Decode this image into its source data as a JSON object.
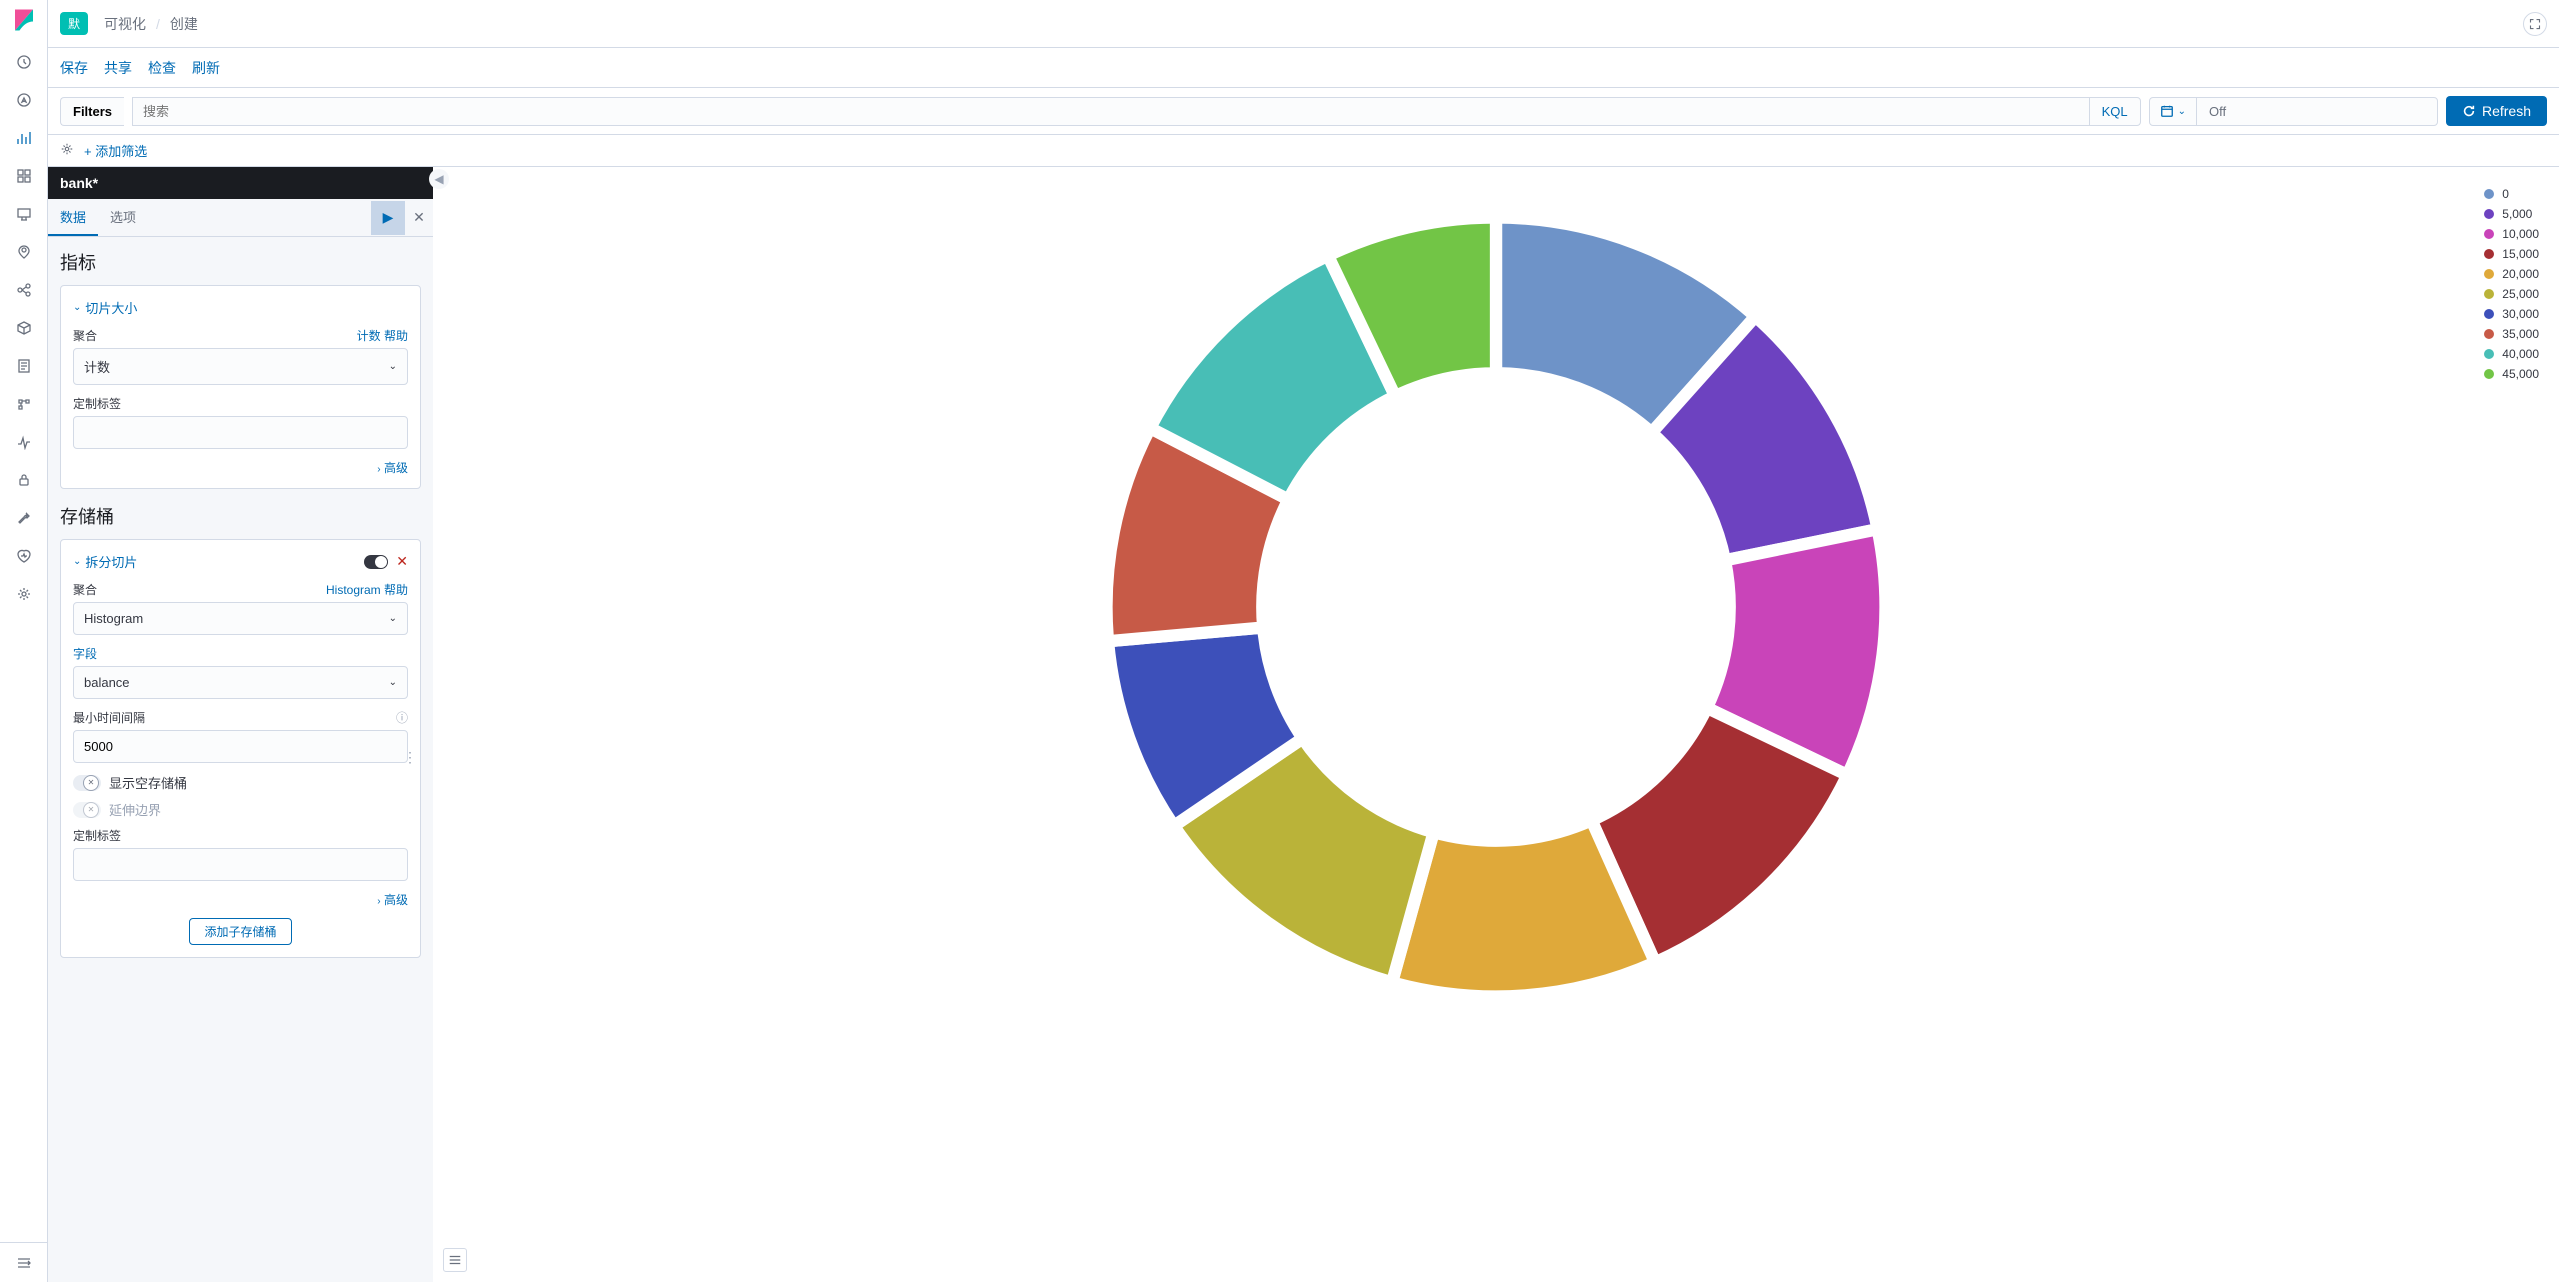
{
  "header": {
    "badge": "默",
    "breadcrumb": [
      "可视化",
      "创建"
    ]
  },
  "actions": {
    "save": "保存",
    "share": "共享",
    "inspect": "检查",
    "refresh_cn": "刷新"
  },
  "query": {
    "filters_btn": "Filters",
    "search_placeholder": "搜索",
    "kql": "KQL",
    "date_range": "Off",
    "refresh": "Refresh"
  },
  "filter_row": {
    "add_filter": "+ 添加筛选"
  },
  "sidebar": {
    "index_pattern": "bank*",
    "tabs": {
      "data": "数据",
      "options": "选项"
    },
    "metrics_title": "指标",
    "metric": {
      "header": "切片大小",
      "agg_label": "聚合",
      "agg_hint": "计数 帮助",
      "agg_value": "计数",
      "custom_label": "定制标签",
      "advanced": "高级"
    },
    "buckets_title": "存储桶",
    "bucket": {
      "header": "拆分切片",
      "agg_label": "聚合",
      "agg_hint": "Histogram 帮助",
      "agg_value": "Histogram",
      "field_label": "字段",
      "field_value": "balance",
      "interval_label": "最小时间间隔",
      "interval_value": "5000",
      "show_empty": "显示空存储桶",
      "extend_bounds": "延伸边界",
      "custom_label": "定制标签",
      "advanced": "高级",
      "add_sub": "添加子存储桶"
    }
  },
  "chart_data": {
    "type": "donut",
    "title": "",
    "series": [
      {
        "label": "0",
        "value": 11.6,
        "color": "#6e93c8"
      },
      {
        "label": "5,000",
        "value": 10.2,
        "color": "#6d42c0"
      },
      {
        "label": "10,000",
        "value": 10.3,
        "color": "#c944b9"
      },
      {
        "label": "15,000",
        "value": 11.2,
        "color": "#a52f33"
      },
      {
        "label": "20,000",
        "value": 11.0,
        "color": "#dfa93a"
      },
      {
        "label": "25,000",
        "value": 11.2,
        "color": "#bab339"
      },
      {
        "label": "30,000",
        "value": 8.1,
        "color": "#3d50ba"
      },
      {
        "label": "35,000",
        "value": 9.0,
        "color": "#c75a47"
      },
      {
        "label": "40,000",
        "value": 10.3,
        "color": "#48beb6"
      },
      {
        "label": "45,000",
        "value": 7.1,
        "color": "#72c546"
      }
    ]
  }
}
